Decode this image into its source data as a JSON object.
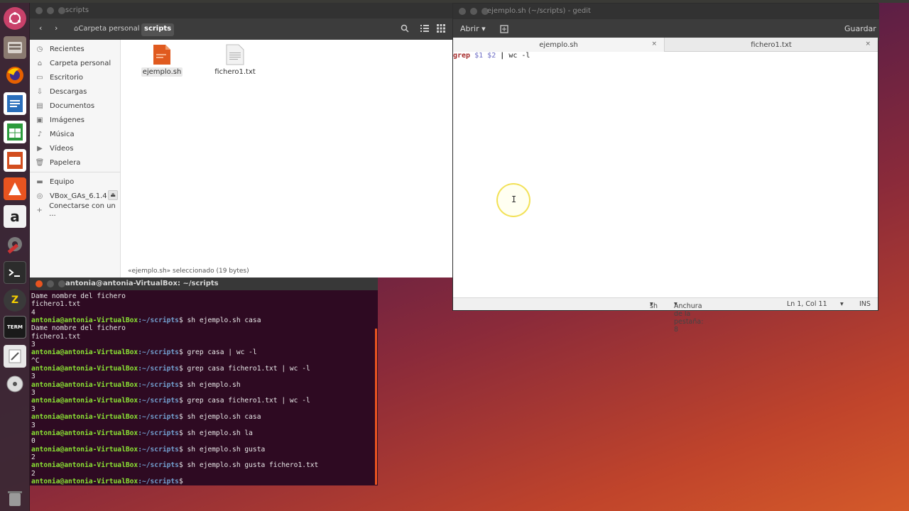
{
  "files_window": {
    "title": "scripts",
    "breadcrumbs": [
      "Carpeta personal",
      "scripts"
    ],
    "sidebar": [
      {
        "label": "Recientes",
        "icon": "clock-icon"
      },
      {
        "label": "Carpeta personal",
        "icon": "home-icon"
      },
      {
        "label": "Escritorio",
        "icon": "folder-icon"
      },
      {
        "label": "Descargas",
        "icon": "download-icon"
      },
      {
        "label": "Documentos",
        "icon": "document-icon"
      },
      {
        "label": "Imágenes",
        "icon": "image-icon"
      },
      {
        "label": "Música",
        "icon": "music-icon"
      },
      {
        "label": "Vídeos",
        "icon": "video-icon"
      },
      {
        "label": "Papelera",
        "icon": "trash-icon"
      },
      {
        "label": "Equipo",
        "icon": "drive-icon"
      },
      {
        "label": "VBox_GAs_6.1.4",
        "icon": "disc-icon"
      },
      {
        "label": "Conectarse con un ...",
        "icon": "network-icon"
      }
    ],
    "files": [
      {
        "name": "ejemplo.sh",
        "icon": "shell-script-icon",
        "selected": true
      },
      {
        "name": "fichero1.txt",
        "icon": "text-file-icon",
        "selected": false
      }
    ],
    "status": "«ejemplo.sh» seleccionado (19 bytes)"
  },
  "gedit": {
    "title": "ejemplo.sh (~/scripts) - gedit",
    "open_label": "Abrir",
    "save_label": "Guardar",
    "tabs": [
      {
        "label": "ejemplo.sh",
        "active": true
      },
      {
        "label": "fichero1.txt",
        "active": false
      }
    ],
    "code": {
      "cmd": "grep",
      "args": "$1 $2",
      "pipe": "|",
      "rest": "wc -l"
    },
    "status": {
      "language": "sh",
      "tab_width": "Anchura de la pestaña: 8",
      "position": "Ln 1, Col 11",
      "mode": "INS"
    }
  },
  "terminal": {
    "title": "antonia@antonia-VirtualBox: ~/scripts",
    "prompt_user": "antonia@antonia-VirtualBox",
    "prompt_path": ":~/scripts",
    "prompt_sym": "$",
    "lines": [
      {
        "type": "out",
        "text": "Dame nombre del fichero"
      },
      {
        "type": "out",
        "text": "fichero1.txt"
      },
      {
        "type": "out",
        "text": "4"
      },
      {
        "type": "cmd",
        "text": " sh ejemplo.sh casa"
      },
      {
        "type": "out",
        "text": "Dame nombre del fichero"
      },
      {
        "type": "out",
        "text": "fichero1.txt"
      },
      {
        "type": "out",
        "text": "3"
      },
      {
        "type": "cmd",
        "text": " grep casa | wc -l"
      },
      {
        "type": "out",
        "text": "^C"
      },
      {
        "type": "cmd",
        "text": " grep casa fichero1.txt | wc -l"
      },
      {
        "type": "out",
        "text": "3"
      },
      {
        "type": "cmd",
        "text": " sh ejemplo.sh"
      },
      {
        "type": "out",
        "text": "3"
      },
      {
        "type": "cmd",
        "text": " grep casa fichero1.txt | wc -l"
      },
      {
        "type": "out",
        "text": "3"
      },
      {
        "type": "cmd",
        "text": " sh ejemplo.sh casa"
      },
      {
        "type": "out",
        "text": "3"
      },
      {
        "type": "cmd",
        "text": " sh ejemplo.sh la"
      },
      {
        "type": "out",
        "text": "0"
      },
      {
        "type": "cmd",
        "text": " sh ejemplo.sh gusta"
      },
      {
        "type": "out",
        "text": "2"
      },
      {
        "type": "cmd",
        "text": " sh ejemplo.sh gusta fichero1.txt"
      },
      {
        "type": "out",
        "text": "2"
      },
      {
        "type": "cmd",
        "text": " "
      }
    ]
  },
  "launcher": [
    {
      "name": "dash-icon",
      "color": "#c9416a"
    },
    {
      "name": "file-manager-icon",
      "color": "#8a7a70"
    },
    {
      "name": "firefox-icon",
      "color": "#e66000"
    },
    {
      "name": "writer-icon",
      "color": "#2a6ebb"
    },
    {
      "name": "calc-icon",
      "color": "#2c9b3c"
    },
    {
      "name": "impress-icon",
      "color": "#d24d1e"
    },
    {
      "name": "software-center-icon",
      "color": "#e95420"
    },
    {
      "name": "amazon-icon",
      "color": "#333333"
    },
    {
      "name": "settings-icon",
      "color": "#6b6b6b"
    },
    {
      "name": "terminal-icon",
      "color": "#2c2c2c"
    },
    {
      "name": "zeal-icon",
      "color": "#444444"
    },
    {
      "name": "xterm-icon",
      "color": "#222222"
    },
    {
      "name": "text-editor-icon",
      "color": "#666666"
    },
    {
      "name": "dvd-icon",
      "color": "#888888"
    },
    {
      "name": "trash-icon",
      "color": "#777777"
    }
  ]
}
